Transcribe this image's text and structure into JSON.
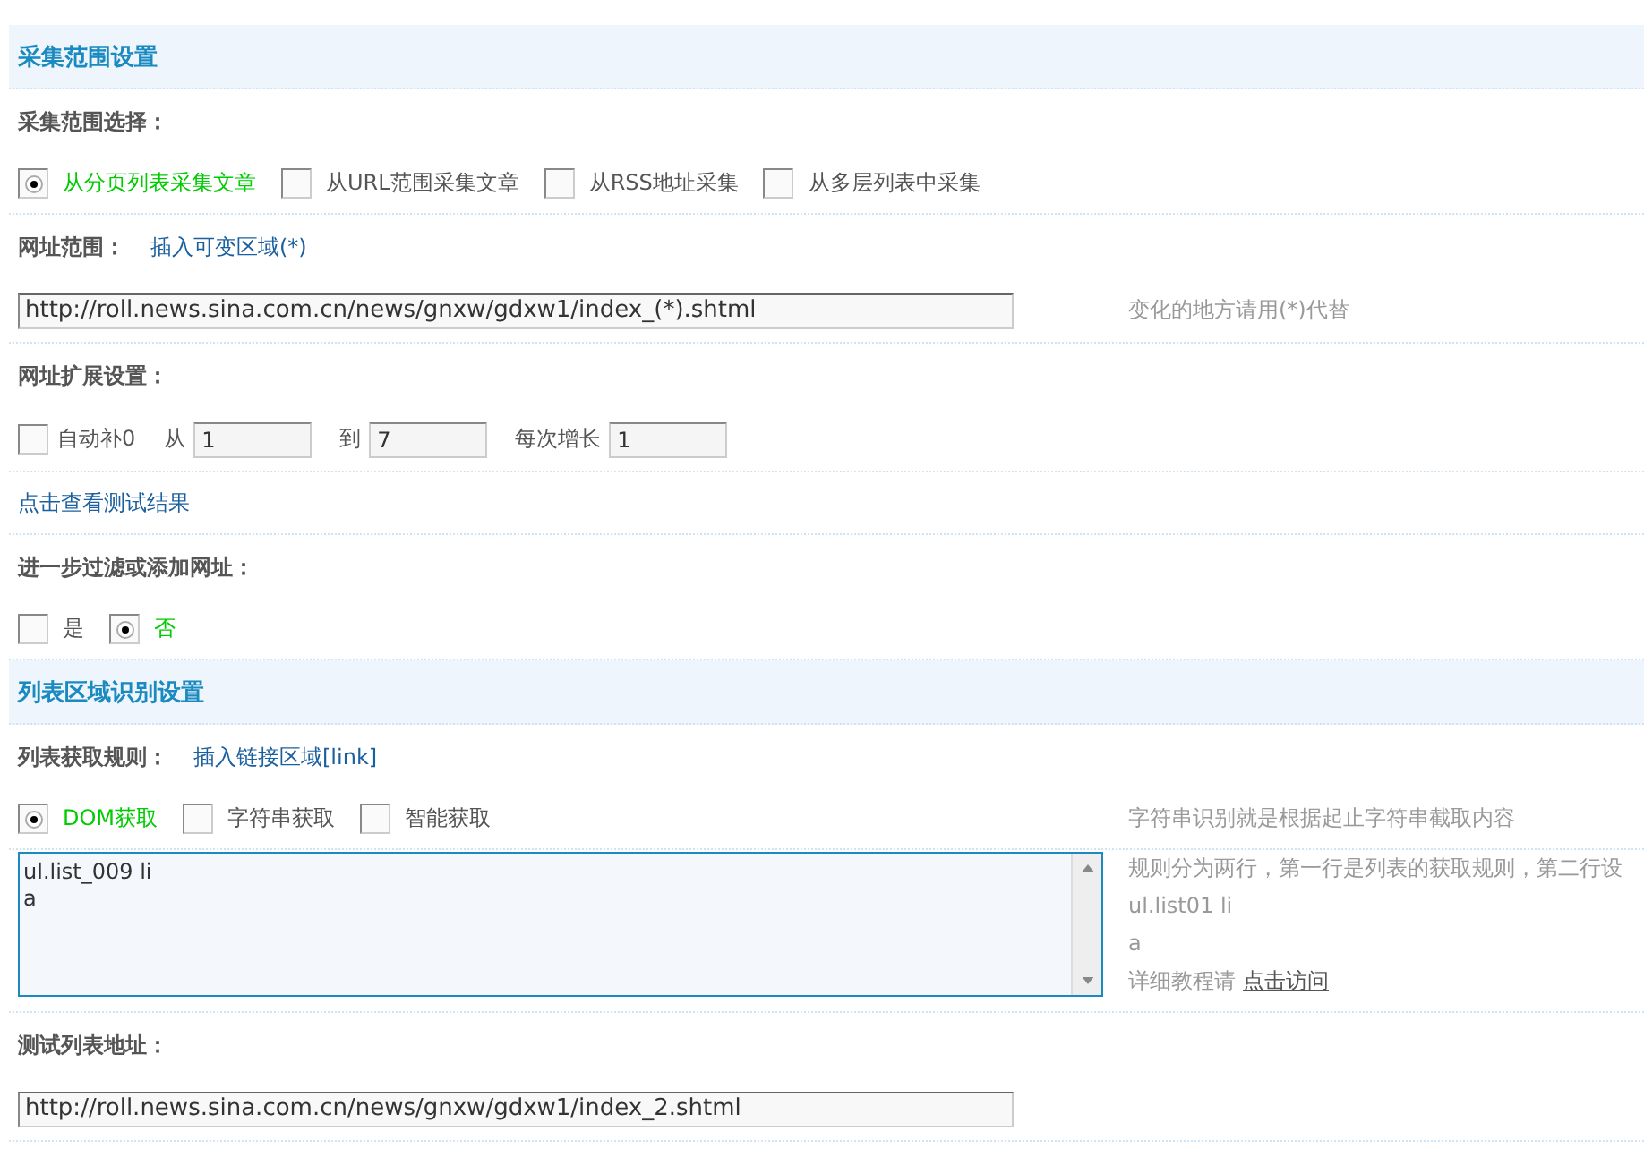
{
  "sections": [
    {
      "title": "采集范围设置",
      "rows": [
        {
          "kind": "heading",
          "label": "采集范围选择："
        },
        {
          "kind": "radios",
          "options": [
            {
              "label": "从分页列表采集文章",
              "selected": true
            },
            {
              "label": "从URL范围采集文章",
              "selected": false
            },
            {
              "label": "从RSS地址采集",
              "selected": false
            },
            {
              "label": "从多层列表中采集",
              "selected": false
            }
          ]
        },
        {
          "kind": "heading",
          "label": "网址范围：",
          "link": "插入可变区域(*)"
        },
        {
          "kind": "input",
          "value": "http://roll.news.sina.com.cn/news/gnxw/gdxw1/index_(*).shtml",
          "hint": "变化的地方请用(*)代替"
        },
        {
          "kind": "heading",
          "label": "网址扩展设置："
        },
        {
          "kind": "range",
          "checkbox": {
            "label": "自动补0",
            "checked": false
          },
          "fields": [
            {
              "label": "从",
              "value": "1"
            },
            {
              "label": "到",
              "value": "7"
            },
            {
              "label": "每次增长",
              "value": "1"
            }
          ]
        },
        {
          "kind": "link",
          "text": "点击查看测试结果"
        },
        {
          "kind": "heading",
          "label": "进一步过滤或添加网址："
        },
        {
          "kind": "radios",
          "options": [
            {
              "label": "是",
              "selected": false
            },
            {
              "label": "否",
              "selected": true
            }
          ]
        }
      ]
    },
    {
      "title": "列表区域识别设置",
      "rows": [
        {
          "kind": "heading",
          "label": "列表获取规则：",
          "link": "插入链接区域[link]"
        },
        {
          "kind": "radios",
          "options": [
            {
              "label": "DOM获取",
              "selected": true
            },
            {
              "label": "字符串获取",
              "selected": false
            },
            {
              "label": "智能获取",
              "selected": false
            }
          ],
          "hint": "字符串识别就是根据起止字符串截取内容"
        },
        {
          "kind": "textarea",
          "lines": [
            "ul.list_009 li",
            "a"
          ],
          "notes": [
            "规则分为两行，第一行是列表的获取规则，第二行设",
            "ul.list01 li",
            "a"
          ],
          "tutorial": {
            "text": "详细教程请",
            "link": "点击访问"
          }
        },
        {
          "kind": "heading",
          "label": "测试列表地址："
        },
        {
          "kind": "input",
          "value": "http://roll.news.sina.com.cn/news/gnxw/gdxw1/index_2.shtml"
        }
      ]
    }
  ]
}
